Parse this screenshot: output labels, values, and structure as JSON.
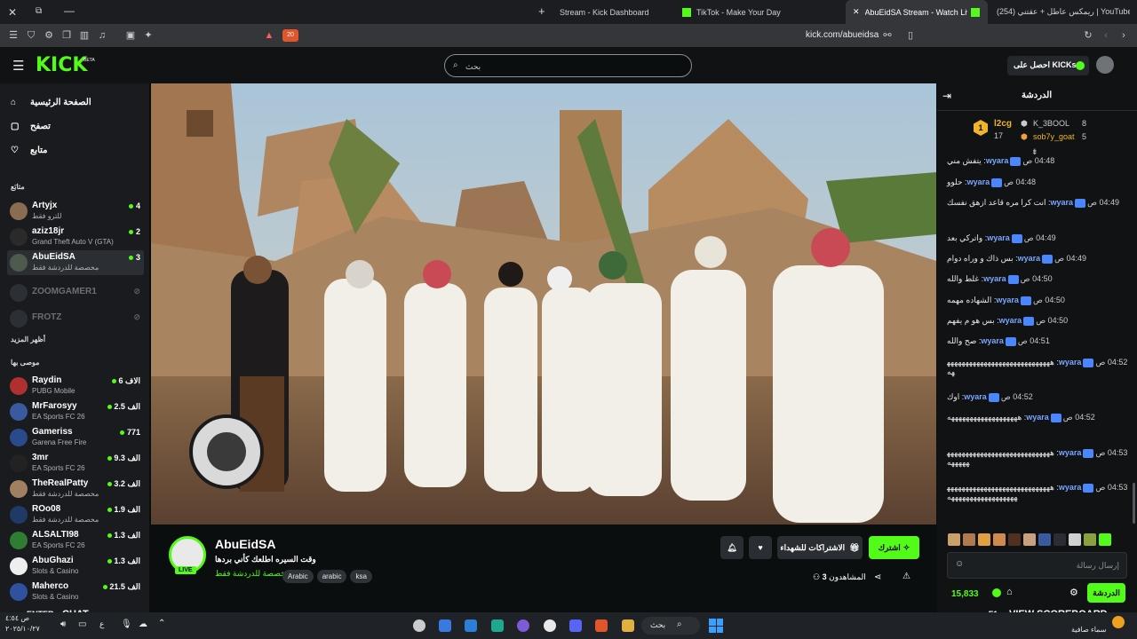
{
  "browser": {
    "tabs": [
      {
        "title": "Stream - Kick Dashboard"
      },
      {
        "title": "TikTok - Make Your Day"
      },
      {
        "title": "AbuEidSA Stream - Watch Live o"
      },
      {
        "title": "(254) ريمكس عاطل + عقتني | YouTube"
      }
    ],
    "url": "kick.com/abueidsa",
    "new_tab": "+",
    "shield_count": "20"
  },
  "kick": {
    "logo": "KICK",
    "logo_beta": "BETA",
    "search_placeholder": "بحث",
    "get_kicks_label": "احصل على KICKs"
  },
  "sidebar": {
    "nav": [
      {
        "label": "الصفحة الرئيسية",
        "icon": "home-icon"
      },
      {
        "label": "تصفح",
        "icon": "browse-icon"
      },
      {
        "label": "متابع",
        "icon": "heart-icon"
      }
    ],
    "following_header": "متابَع",
    "following": [
      {
        "name": "Artyjx",
        "sub": "للترو فقط",
        "viewers": "4",
        "live": true
      },
      {
        "name": "aziz18jr",
        "sub": "Grand Theft Auto V (GTA)",
        "viewers": "2",
        "live": true
      },
      {
        "name": "AbuEidSA",
        "sub": "مخصصة للدردشة فقط",
        "viewers": "3",
        "live": true
      },
      {
        "name": "ZOOMGAMER1",
        "sub": "",
        "viewers": "",
        "live": false
      },
      {
        "name": "FROTZ",
        "sub": "",
        "viewers": "",
        "live": false
      }
    ],
    "show_more": "أظهر المزيد",
    "recommended_header": "موصى بها",
    "recommended": [
      {
        "name": "Raydin",
        "sub": "PUBG Mobile",
        "viewers": "6 الاف"
      },
      {
        "name": "MrFarosyy",
        "sub": "EA Sports FC 26",
        "viewers": "2.5 الف"
      },
      {
        "name": "Gameriss",
        "sub": "Garena Free Fire",
        "viewers": "771"
      },
      {
        "name": "3mr",
        "sub": "EA Sports FC 26",
        "viewers": "9.3 الف"
      },
      {
        "name": "TheRealPatty",
        "sub": "مخصصة للدردشة فقط",
        "viewers": "3.2 الف"
      },
      {
        "name": "ROo08",
        "sub": "مخصصة للدردشة فقط",
        "viewers": "1.9 الف"
      },
      {
        "name": "ALSALTI98",
        "sub": "EA Sports FC 26",
        "viewers": "1.3 الف"
      },
      {
        "name": "AbuGhazi",
        "sub": "Slots & Casino",
        "viewers": "1.3 الف"
      },
      {
        "name": "Maherco",
        "sub": "Slots & Casino",
        "viewers": "21.5 الف"
      }
    ]
  },
  "stream": {
    "live_badge": "LIVE",
    "channel": "AbuEidSA",
    "title": "وقت السيره اطلعك كأني بردها",
    "category": "مخصصة للدردشة فقط",
    "tags": [
      "Arabic",
      "arabic",
      "ksa"
    ],
    "subscribe_label": "اشترك",
    "gift_label": "الاشتراكات للشهداء",
    "viewers_label": "المشاهدون",
    "viewers_count": "3"
  },
  "chat": {
    "title": "الدردشة",
    "leaderboard": [
      {
        "name": "l2cg",
        "value": "17",
        "rank": "1"
      },
      {
        "name": "K_3BOOL",
        "value": "8"
      },
      {
        "name": "sob7y_goat",
        "value": "5"
      }
    ],
    "messages": [
      {
        "time": "04:48 ص",
        "user": "wyara",
        "text": "يتفش مني"
      },
      {
        "time": "04:48 ص",
        "user": "wyara",
        "text": "حلوو"
      },
      {
        "time": "04:49 ص",
        "user": "wyara",
        "text": "انت كرا مره قاعد ازهق نفسك"
      },
      {
        "time": "04:49 ص",
        "user": "wyara",
        "text": "واتركي بعد"
      },
      {
        "time": "04:49 ص",
        "user": "wyara",
        "text": "بس ذاك و وراه دوام"
      },
      {
        "time": "04:50 ص",
        "user": "wyara",
        "text": "غلط والله"
      },
      {
        "time": "04:50 ص",
        "user": "wyara",
        "text": "الشهاده مهمه"
      },
      {
        "time": "04:50 ص",
        "user": "wyara",
        "text": "بس هو م يفهم"
      },
      {
        "time": "04:51 ص",
        "user": "wyara",
        "text": "صح والله"
      },
      {
        "time": "04:52 ص",
        "user": "wyara",
        "text": "ههههههههههههههههههههههههههههههه"
      },
      {
        "time": "04:52 ص",
        "user": "wyara",
        "text": "اوك"
      },
      {
        "time": "04:52 ص",
        "user": "wyara",
        "text": "هههههههههههههههههههه"
      },
      {
        "time": "04:53 ص",
        "user": "wyara",
        "text": "ههههههههههههههههههههههههههههههههههه"
      },
      {
        "time": "04:53 ص",
        "user": "wyara",
        "text": "هههههههههههههههههههههههههههههههههههههههههههههههه"
      }
    ],
    "input_placeholder": "إرسال رسالة",
    "points": "15,833",
    "chat_button": "الدردشة"
  },
  "overlay": {
    "enter": "ENTER",
    "chat": "CHAT",
    "f1": "F1",
    "scoreboard": "VIEW SCOREBOARD"
  },
  "taskbar": {
    "search": "بحث",
    "time": "ص ٤:٥٤",
    "date": "٢٠٢٥/١٠/٢٧",
    "weather": "سماء صافية"
  },
  "colors": {
    "accent": "#53fc18",
    "chat_user": "#7aa7ff",
    "bg": "#0b0e0f"
  }
}
